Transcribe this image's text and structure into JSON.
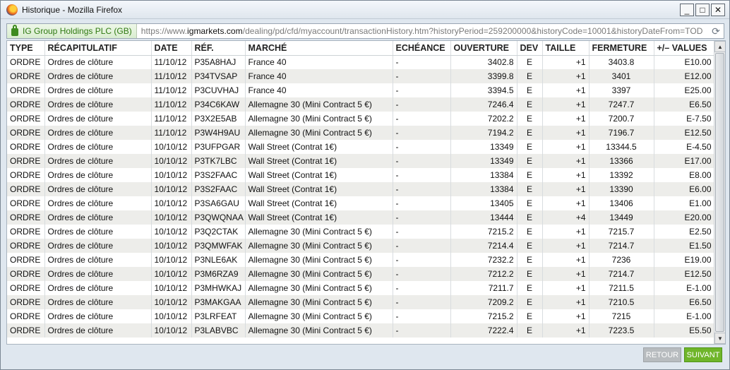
{
  "window": {
    "title": "Historique - Mozilla Firefox",
    "controls": {
      "minimize": "_",
      "maximize": "□",
      "close": "✕"
    }
  },
  "address": {
    "site_identity": "IG Group Holdings PLC (GB)",
    "url_prefix": "https://www.",
    "url_domain": "igmarkets.com",
    "url_rest": "/dealing/pd/cfd/myaccount/transactionHistory.htm?historyPeriod=259200000&historyCode=10001&historyDateFrom=TOD"
  },
  "table": {
    "headers": [
      "TYPE",
      "RÉCAPITULATIF",
      "DATE",
      "RÉF.",
      "MARCHÉ",
      "ECHÉANCE",
      "OUVERTURE",
      "DEV",
      "TAILLE",
      "FERMETURE",
      "+/– VALUES"
    ],
    "rows": [
      [
        "ORDRE",
        "Ordres de clôture",
        "11/10/12",
        "P35A8HAJ",
        "France 40",
        "-",
        "3402.8",
        "E",
        "+1",
        "3403.8",
        "E10.00"
      ],
      [
        "ORDRE",
        "Ordres de clôture",
        "11/10/12",
        "P34TVSAP",
        "France 40",
        "-",
        "3399.8",
        "E",
        "+1",
        "3401",
        "E12.00"
      ],
      [
        "ORDRE",
        "Ordres de clôture",
        "11/10/12",
        "P3CUVHAJ",
        "France 40",
        "-",
        "3394.5",
        "E",
        "+1",
        "3397",
        "E25.00"
      ],
      [
        "ORDRE",
        "Ordres de clôture",
        "11/10/12",
        "P34C6KAW",
        "Allemagne 30 (Mini Contract 5 €)",
        "-",
        "7246.4",
        "E",
        "+1",
        "7247.7",
        "E6.50"
      ],
      [
        "ORDRE",
        "Ordres de clôture",
        "11/10/12",
        "P3X2E5AB",
        "Allemagne 30 (Mini Contract 5 €)",
        "-",
        "7202.2",
        "E",
        "+1",
        "7200.7",
        "E-7.50"
      ],
      [
        "ORDRE",
        "Ordres de clôture",
        "11/10/12",
        "P3W4H9AU",
        "Allemagne 30 (Mini Contract 5 €)",
        "-",
        "7194.2",
        "E",
        "+1",
        "7196.7",
        "E12.50"
      ],
      [
        "ORDRE",
        "Ordres de clôture",
        "10/10/12",
        "P3UFPGAR",
        "Wall Street (Contrat 1€)",
        "-",
        "13349",
        "E",
        "+1",
        "13344.5",
        "E-4.50"
      ],
      [
        "ORDRE",
        "Ordres de clôture",
        "10/10/12",
        "P3TK7LBC",
        "Wall Street (Contrat 1€)",
        "-",
        "13349",
        "E",
        "+1",
        "13366",
        "E17.00"
      ],
      [
        "ORDRE",
        "Ordres de clôture",
        "10/10/12",
        "P3S2FAAC",
        "Wall Street (Contrat 1€)",
        "-",
        "13384",
        "E",
        "+1",
        "13392",
        "E8.00"
      ],
      [
        "ORDRE",
        "Ordres de clôture",
        "10/10/12",
        "P3S2FAAC",
        "Wall Street (Contrat 1€)",
        "-",
        "13384",
        "E",
        "+1",
        "13390",
        "E6.00"
      ],
      [
        "ORDRE",
        "Ordres de clôture",
        "10/10/12",
        "P3SA6GAU",
        "Wall Street (Contrat 1€)",
        "-",
        "13405",
        "E",
        "+1",
        "13406",
        "E1.00"
      ],
      [
        "ORDRE",
        "Ordres de clôture",
        "10/10/12",
        "P3QWQNAA",
        "Wall Street (Contrat 1€)",
        "-",
        "13444",
        "E",
        "+4",
        "13449",
        "E20.00"
      ],
      [
        "ORDRE",
        "Ordres de clôture",
        "10/10/12",
        "P3Q2CTAK",
        "Allemagne 30 (Mini Contract 5 €)",
        "-",
        "7215.2",
        "E",
        "+1",
        "7215.7",
        "E2.50"
      ],
      [
        "ORDRE",
        "Ordres de clôture",
        "10/10/12",
        "P3QMWFAK",
        "Allemagne 30 (Mini Contract 5 €)",
        "-",
        "7214.4",
        "E",
        "+1",
        "7214.7",
        "E1.50"
      ],
      [
        "ORDRE",
        "Ordres de clôture",
        "10/10/12",
        "P3NLE6AK",
        "Allemagne 30 (Mini Contract 5 €)",
        "-",
        "7232.2",
        "E",
        "+1",
        "7236",
        "E19.00"
      ],
      [
        "ORDRE",
        "Ordres de clôture",
        "10/10/12",
        "P3M6RZA9",
        "Allemagne 30 (Mini Contract 5 €)",
        "-",
        "7212.2",
        "E",
        "+1",
        "7214.7",
        "E12.50"
      ],
      [
        "ORDRE",
        "Ordres de clôture",
        "10/10/12",
        "P3MHWKAJ",
        "Allemagne 30 (Mini Contract 5 €)",
        "-",
        "7211.7",
        "E",
        "+1",
        "7211.5",
        "E-1.00"
      ],
      [
        "ORDRE",
        "Ordres de clôture",
        "10/10/12",
        "P3MAKGAA",
        "Allemagne 30 (Mini Contract 5 €)",
        "-",
        "7209.2",
        "E",
        "+1",
        "7210.5",
        "E6.50"
      ],
      [
        "ORDRE",
        "Ordres de clôture",
        "10/10/12",
        "P3LRFEAT",
        "Allemagne 30 (Mini Contract 5 €)",
        "-",
        "7215.2",
        "E",
        "+1",
        "7215",
        "E-1.00"
      ],
      [
        "ORDRE",
        "Ordres de clôture",
        "10/10/12",
        "P3LABVBC",
        "Allemagne 30 (Mini Contract 5 €)",
        "-",
        "7222.4",
        "E",
        "+1",
        "7223.5",
        "E5.50"
      ]
    ]
  },
  "footer": {
    "retour": "RETOUR",
    "suivant": "SUIVANT"
  },
  "colors": {
    "row_alt": "#ededea",
    "suivant_green": "#6fb52a",
    "retour_gray": "#b8bcbf",
    "secure_green": "#2f7a12"
  },
  "icons": {
    "browser": "firefox-icon",
    "secure": "lock-icon",
    "reload": "reload-icon"
  }
}
